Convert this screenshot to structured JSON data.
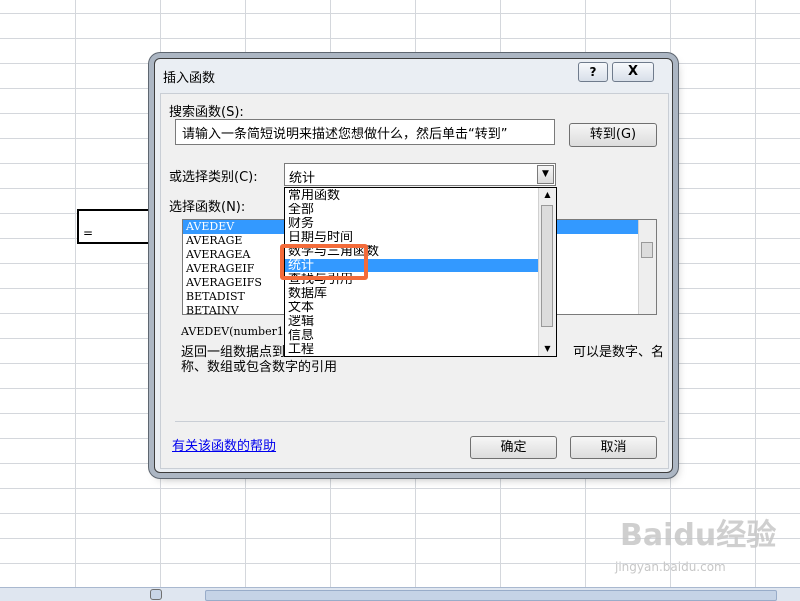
{
  "cell": {
    "formula": "="
  },
  "dialog": {
    "title": "插入函数",
    "help_glyph": "?",
    "close_glyph": "X",
    "search_label": "搜索函数(S):",
    "search_text": "请输入一条简短说明来描述您想做什么，然后单击“转到”",
    "go_button": "转到(G)",
    "category_label": "或选择类别(C):",
    "category_value": "统计",
    "select_label": "选择函数(N):",
    "functions": [
      "AVEDEV",
      "AVERAGE",
      "AVERAGEA",
      "AVERAGEIF",
      "AVERAGEIFS",
      "BETADIST",
      "BETAINV"
    ],
    "signature": "AVEDEV(number1",
    "description_line1": "返回一组数据点到",
    "description_tail": "可以是数字、名",
    "description_line2": "称、数组或包含数字的引用",
    "help_link": "有关该函数的帮助",
    "ok_button": "确定",
    "cancel_button": "取消"
  },
  "dropdown": {
    "items": [
      "常用函数",
      "全部",
      "财务",
      "日期与时间",
      "数学与三角函数",
      "统计",
      "查找与引用",
      "数据库",
      "文本",
      "逻辑",
      "信息",
      "工程"
    ],
    "selected_index": 5
  },
  "watermark": {
    "brand": "Baidu经验",
    "url": "jingyan.baidu.com"
  }
}
